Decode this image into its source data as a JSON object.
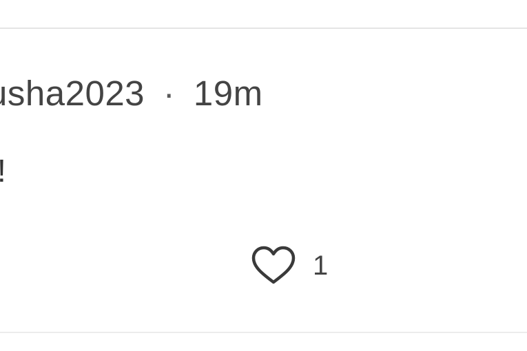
{
  "comment": {
    "username": "usha2023",
    "separator": "·",
    "timestamp": "19m",
    "text": "!",
    "likes": {
      "icon": "heart-outline-icon",
      "count": "1"
    }
  },
  "colors": {
    "text": "#444444",
    "divider": "#e4e4e4",
    "background": "#ffffff"
  }
}
